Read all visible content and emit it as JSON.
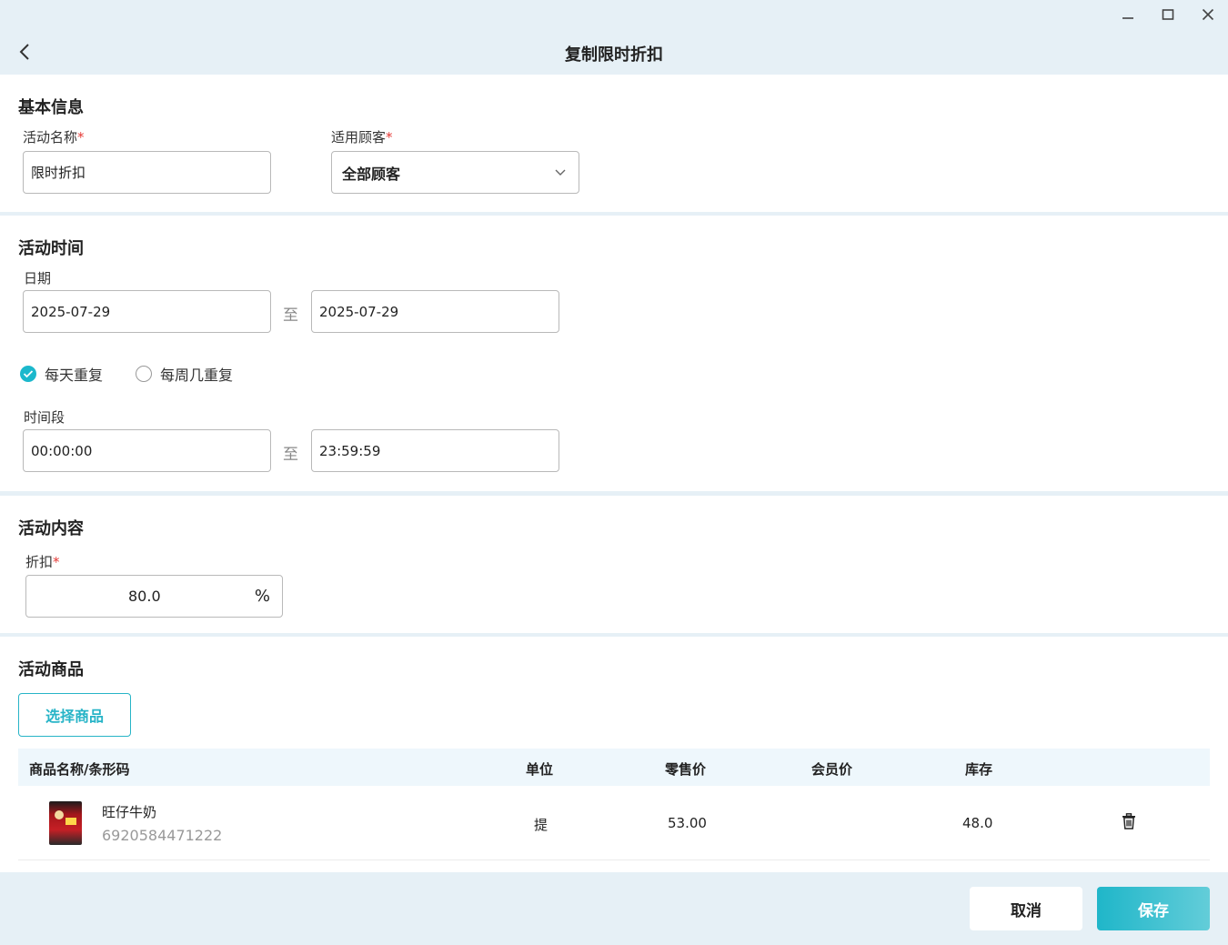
{
  "header": {
    "title": "复制限时折扣"
  },
  "basic_info": {
    "section_title": "基本信息",
    "activity_name_label": "活动名称",
    "activity_name_value": "限时折扣",
    "customer_label": "适用顾客",
    "customer_value": "全部顾客",
    "required_mark": "*"
  },
  "activity_time": {
    "section_title": "活动时间",
    "date_label": "日期",
    "start_date": "2025-07-29",
    "end_date": "2025-07-29",
    "to_char": "至",
    "repeat_daily_label": "每天重复",
    "repeat_daily_checked": true,
    "repeat_weekly_label": "每周几重复",
    "repeat_weekly_checked": false,
    "period_label": "时间段",
    "start_time": "00:00:00",
    "end_time": "23:59:59"
  },
  "activity_content": {
    "section_title": "活动内容",
    "discount_label": "折扣",
    "discount_value": "80.0",
    "discount_unit": "%"
  },
  "activity_goods": {
    "section_title": "活动商品",
    "select_button": "选择商品",
    "columns": {
      "name": "商品名称/条形码",
      "unit": "单位",
      "retail_price": "零售价",
      "member_price": "会员价",
      "stock": "库存"
    },
    "rows": [
      {
        "name": "旺仔牛奶",
        "barcode": "6920584471222",
        "unit": "提",
        "retail_price": "53.00",
        "member_price": "",
        "stock": "48.0"
      }
    ]
  },
  "footer": {
    "cancel_label": "取消",
    "save_label": "保存"
  },
  "colors": {
    "accent": "#1cb8cc",
    "required": "#e53935",
    "background": "#e6f0f6"
  }
}
